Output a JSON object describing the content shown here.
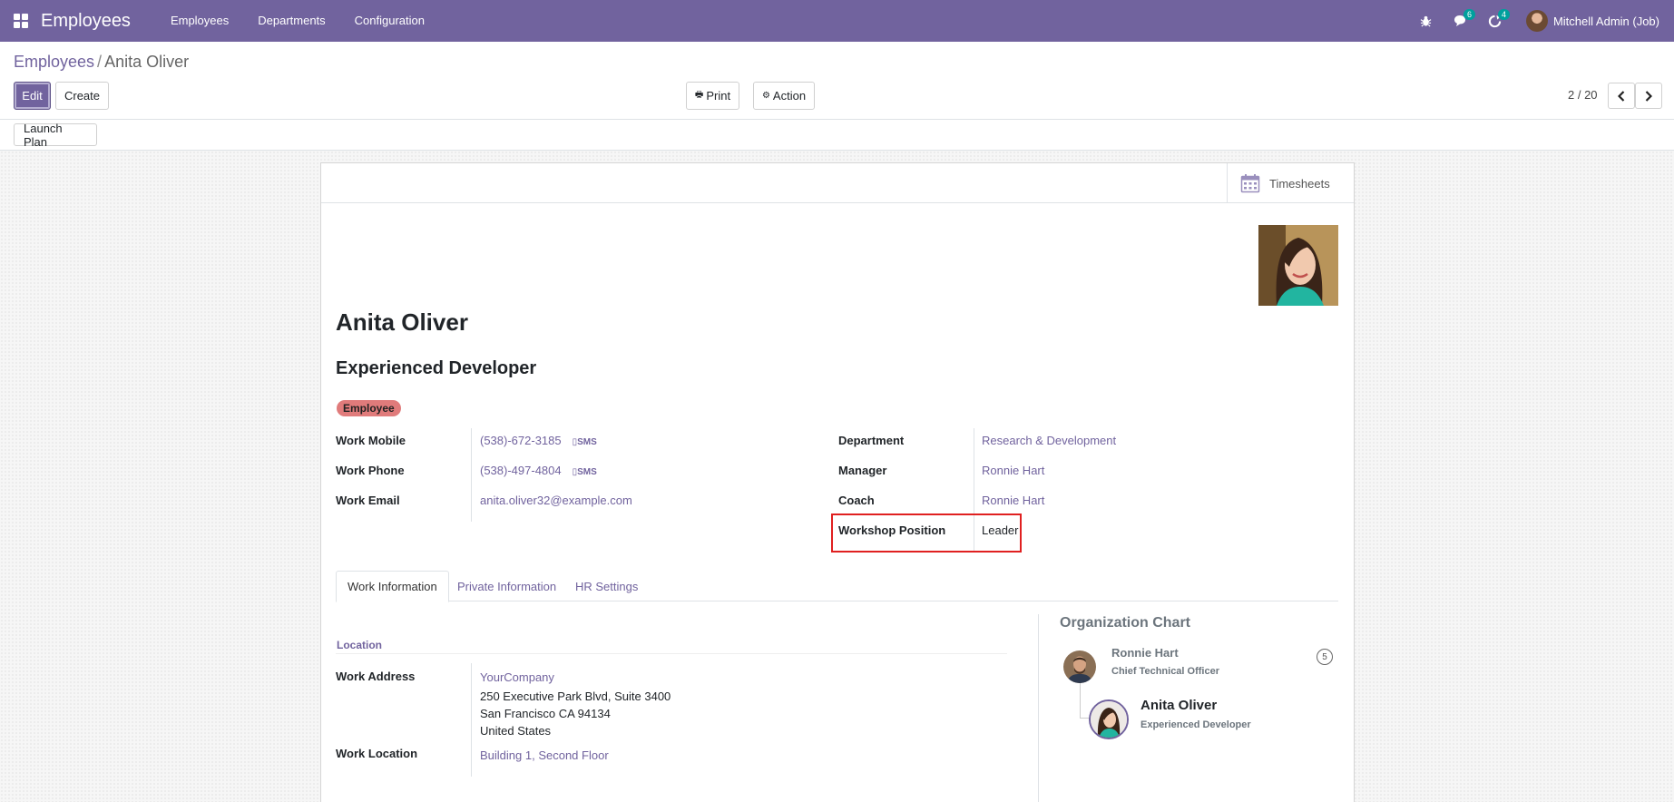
{
  "navbar": {
    "app_title": "Employees",
    "menu": [
      "Employees",
      "Departments",
      "Configuration"
    ],
    "messages_count": "6",
    "activities_count": "4",
    "user_name": "Mitchell Admin (Job)"
  },
  "breadcrumb": {
    "parent": "Employees",
    "separator": "/",
    "current": "Anita Oliver"
  },
  "toolbar": {
    "edit_label": "Edit",
    "create_label": "Create",
    "print_label": "Print",
    "action_label": "Action",
    "pager_value": "2 / 20"
  },
  "statusbar": {
    "launch_plan_label": "Launch Plan"
  },
  "smart_buttons": {
    "timesheets_label": "Timesheets"
  },
  "employee": {
    "name": "Anita Oliver",
    "job_title": "Experienced Developer",
    "tag": "Employee"
  },
  "fields_left": [
    {
      "label": "Work Mobile",
      "value": "(538)-672-3185",
      "sms": "SMS"
    },
    {
      "label": "Work Phone",
      "value": "(538)-497-4804",
      "sms": "SMS"
    },
    {
      "label": "Work Email",
      "value": "anita.oliver32@example.com"
    }
  ],
  "fields_right": [
    {
      "label": "Department",
      "value": "Research & Development"
    },
    {
      "label": "Manager",
      "value": "Ronnie Hart"
    },
    {
      "label": "Coach",
      "value": "Ronnie Hart"
    },
    {
      "label": "Workshop Position",
      "value": "Leader"
    }
  ],
  "tabs": [
    "Work Information",
    "Private Information",
    "HR Settings"
  ],
  "work_info": {
    "group_title": "Location",
    "work_address_label": "Work Address",
    "address_company": "YourCompany",
    "address_line1": "250 Executive Park Blvd, Suite 3400",
    "address_line2": "San Francisco CA 94134",
    "address_line3": "United States",
    "work_location_label": "Work Location",
    "work_location_value": "Building 1, Second Floor"
  },
  "org_chart": {
    "title": "Organization Chart",
    "manager_name": "Ronnie Hart",
    "manager_title": "Chief Technical Officer",
    "manager_subordinates": "5",
    "self_name": "Anita Oliver",
    "self_title": "Experienced Developer"
  },
  "colors": {
    "brand": "#71639e",
    "tag": "#e07b7b",
    "badge": "#00a09d",
    "highlight": "#e02020"
  }
}
